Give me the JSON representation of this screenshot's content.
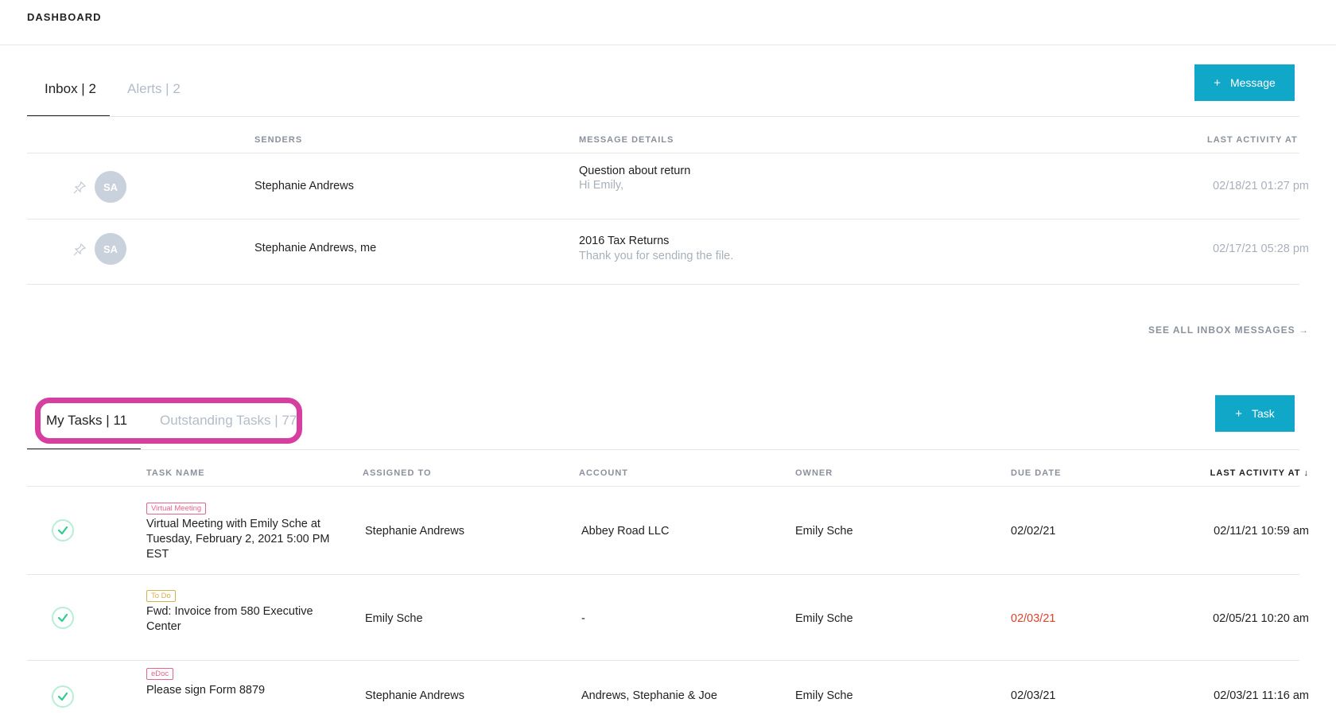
{
  "header": {
    "title": "DASHBOARD"
  },
  "inbox": {
    "tabs": [
      {
        "label": "Inbox | 2",
        "active": true
      },
      {
        "label": "Alerts | 2",
        "active": false
      }
    ],
    "new_button": {
      "icon": "plus-icon",
      "label": "Message"
    },
    "columns": {
      "senders": "SENDERS",
      "details": "MESSAGE DETAILS",
      "last_activity": "LAST ACTIVITY AT"
    },
    "messages": [
      {
        "initials": "SA",
        "sender": "Stephanie Andrews",
        "subject": "Question about return",
        "preview": "Hi Emily,",
        "last_activity": "02/18/21 01:27 pm"
      },
      {
        "initials": "SA",
        "sender": "Stephanie Andrews, me",
        "subject": "2016 Tax Returns",
        "preview": "Thank you for sending the file.",
        "last_activity": "02/17/21 05:28 pm"
      }
    ],
    "see_all": "SEE ALL INBOX MESSAGES →"
  },
  "tasks": {
    "tabs": [
      {
        "label": "My Tasks | 11",
        "active": true
      },
      {
        "label": "Outstanding Tasks | 77",
        "active": false
      }
    ],
    "new_button": {
      "icon": "plus-icon",
      "label": "Task"
    },
    "columns": {
      "task_name": "TASK NAME",
      "assigned_to": "ASSIGNED TO",
      "account": "ACCOUNT",
      "owner": "OWNER",
      "due_date": "DUE DATE",
      "last_activity": "LAST ACTIVITY AT ↓"
    },
    "rows": [
      {
        "tag": "Virtual Meeting",
        "tag_color": "#e7648a",
        "name_line1": "Virtual Meeting with Emily Sche at",
        "name_line2": "Tuesday, February 2, 2021 5:00 PM EST",
        "assigned_to": "Stephanie Andrews",
        "account": "Abbey Road LLC",
        "owner": "Emily Sche",
        "due_date": "02/02/21",
        "overdue": false,
        "last_activity": "02/11/21 10:59 am"
      },
      {
        "tag": "To Do",
        "tag_color": "#d7b24a",
        "name_line1": "Fwd: Invoice from 580 Executive",
        "name_line2": "Center",
        "assigned_to": "Emily Sche",
        "account": "-",
        "owner": "Emily Sche",
        "due_date": "02/03/21",
        "overdue": true,
        "last_activity": "02/05/21 10:20 am"
      },
      {
        "tag": "eDoc",
        "tag_color": "#e7648a",
        "name_line1": "Please sign Form 8879",
        "name_line2": "",
        "assigned_to": "Stephanie Andrews",
        "account": "Andrews, Stephanie & Joe",
        "owner": "Emily Sche",
        "due_date": "02/03/21",
        "overdue": false,
        "last_activity": "02/03/21 11:16 am"
      }
    ]
  },
  "colors": {
    "accent": "#11a7c8",
    "highlight": "#d63fa0",
    "overdue": "#e0412d",
    "check": "#2ecc8f"
  }
}
